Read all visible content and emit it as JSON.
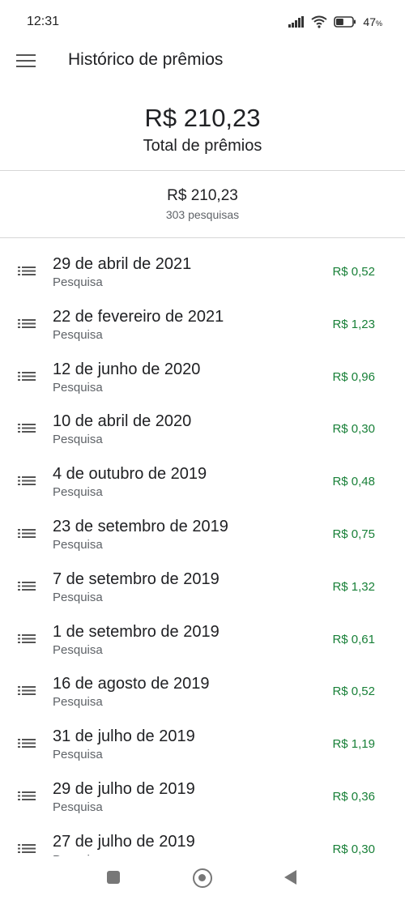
{
  "status_bar": {
    "time": "12:31",
    "battery_percent": "47",
    "battery_symbol": "%",
    "battery_level": 0.47
  },
  "app_bar": {
    "title": "Histórico de prêmios",
    "menu_icon": "hamburger-menu-icon"
  },
  "summary": {
    "total_amount": "R$ 210,23",
    "total_label": "Total de prêmios"
  },
  "sub_summary": {
    "amount": "R$ 210,23",
    "count": "303 pesquisas"
  },
  "colors": {
    "amount_green": "#188038",
    "text_primary": "#202124",
    "text_secondary": "#5f6368"
  },
  "history": [
    {
      "date": "29 de abril de 2021",
      "type": "Pesquisa",
      "amount": "R$ 0,52"
    },
    {
      "date": "22 de fevereiro de 2021",
      "type": "Pesquisa",
      "amount": "R$ 1,23"
    },
    {
      "date": "12 de junho de 2020",
      "type": "Pesquisa",
      "amount": "R$ 0,96"
    },
    {
      "date": "10 de abril de 2020",
      "type": "Pesquisa",
      "amount": "R$ 0,30"
    },
    {
      "date": "4 de outubro de 2019",
      "type": "Pesquisa",
      "amount": "R$ 0,48"
    },
    {
      "date": "23 de setembro de 2019",
      "type": "Pesquisa",
      "amount": "R$ 0,75"
    },
    {
      "date": "7 de setembro de 2019",
      "type": "Pesquisa",
      "amount": "R$ 1,32"
    },
    {
      "date": "1 de setembro de 2019",
      "type": "Pesquisa",
      "amount": "R$ 0,61"
    },
    {
      "date": "16 de agosto de 2019",
      "type": "Pesquisa",
      "amount": "R$ 0,52"
    },
    {
      "date": "31 de julho de 2019",
      "type": "Pesquisa",
      "amount": "R$ 1,19"
    },
    {
      "date": "29 de julho de 2019",
      "type": "Pesquisa",
      "amount": "R$ 0,36"
    },
    {
      "date": "27 de julho de 2019",
      "type": "Pesquisa",
      "amount": "R$ 0,30"
    }
  ],
  "nav_bar": {
    "recents_icon": "square-recents-icon",
    "home_icon": "circle-home-icon",
    "back_icon": "triangle-back-icon"
  }
}
